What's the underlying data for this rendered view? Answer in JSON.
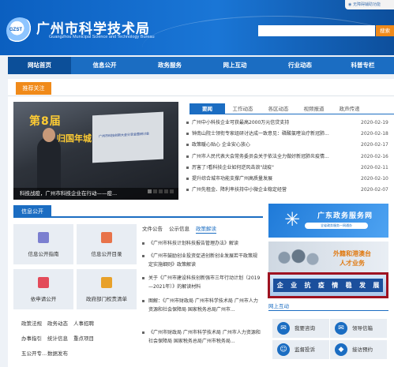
{
  "header": {
    "logo_text": "GZST",
    "site_title": "广州市科学技术局",
    "site_subtitle": "Guangzhou Municipal Science and Technology Bureau",
    "top_right_label": "无障碍辅助功能",
    "search_button_label": "搜索",
    "search_placeholder": ""
  },
  "nav": {
    "items": [
      "网站首页",
      "信息公开",
      "政务服务",
      "网上互动",
      "行业动态",
      "科普专栏"
    ],
    "active_index": 0
  },
  "recommend": {
    "label": "推荐关注",
    "slide_caption": "科技战疫，广州市科技企业在行动——疫...",
    "slide_text_1": "第8届",
    "slide_text_2": "归国年城",
    "screen_text": "广州市科技创新大会分享会暨研讨会",
    "slide_count": 5,
    "active_slide": 0
  },
  "news_tabs": {
    "items": [
      "要闻",
      "工作动态",
      "各区动态",
      "视频报道",
      "政声传递"
    ],
    "active_index": 0
  },
  "news": [
    {
      "title": "广州中小科技企业可获最高2000万元信贷支持",
      "date": "2020-02-19"
    },
    {
      "title": "钟南山院士领衔专家组研讨达成一致意见：磷酸氯喹治疗新冠肺...",
      "date": "2020-02-18"
    },
    {
      "title": "政策暖心贴心 企业安心放心",
      "date": "2020-02-17"
    },
    {
      "title": "广州市人民代表大会常务委员会关于依法全力做好新冠肺炎疫情...",
      "date": "2020-02-16"
    },
    {
      "title": "厉害了!看科技企业如何逆风击浪\"战疫\"",
      "date": "2020-02-11"
    },
    {
      "title": "提升综合城市功能支撑广州高质量发展",
      "date": "2020-02-10"
    },
    {
      "title": "广州先租金、降利率扶持中小微企业稳定经营",
      "date": "2020-02-07"
    }
  ],
  "info_public": {
    "label": "信息公开",
    "tiles": [
      {
        "label": "信息公开指南",
        "color": "#7b7fd0"
      },
      {
        "label": "信息公开目录",
        "color": "#e8734a"
      },
      {
        "label": "依申请公开",
        "color": "#e34b5a"
      },
      {
        "label": "政府部门权责清单",
        "color": "#e8a12a"
      }
    ],
    "links": [
      "政策法规",
      "政务动态",
      "人事招聘",
      "办事指引",
      "统计信息",
      "重点项目",
      "五公开专...",
      "数据发布"
    ]
  },
  "doc_tabs": {
    "items": [
      "文件公告",
      "公示信息",
      "政策解读"
    ],
    "active_index": 2
  },
  "docs": [
    {
      "title": "《广州市科技计划科技报告管理办法》解读",
      "sub": ""
    },
    {
      "title": "《广州市鼓励创业投资促进创新创业发展若干政策规定实施细则》政策解读",
      "sub": ""
    },
    {
      "title": "关于《广州市建设科技创新强市三年行动计划（2019—2021年）》的解读材料",
      "sub": ""
    },
    {
      "title": "图解：《广州市财政局 广州市科学技术局 广州市人力资源和社会保障局 国家税务总局广州市...",
      "sub": ""
    },
    {
      "title": "《广州市财政局 广州市科学技术局 广州市人力资源和社会保障局 国家税务总局广州市税务局...",
      "sub": ""
    }
  ],
  "side": {
    "gdzw_title": "广东政务服务网",
    "gdzw_sub": "全省政务服务一网通办",
    "talent_line1": "外籍和港澳台",
    "talent_line2": "人才业务",
    "epidemic_chars": [
      "企",
      "业",
      "抗",
      "疫",
      "情",
      "稳",
      "发",
      "展"
    ],
    "interact_label": "网上互动",
    "services": [
      {
        "label": "我要咨询",
        "icon": "consult-icon",
        "glyph": "✉"
      },
      {
        "label": "领导信箱",
        "icon": "mailbox-icon",
        "glyph": "✉"
      },
      {
        "label": "监督投诉",
        "icon": "complaint-icon",
        "glyph": "☺"
      },
      {
        "label": "接访预约",
        "icon": "appointment-icon",
        "glyph": "◆"
      }
    ]
  }
}
